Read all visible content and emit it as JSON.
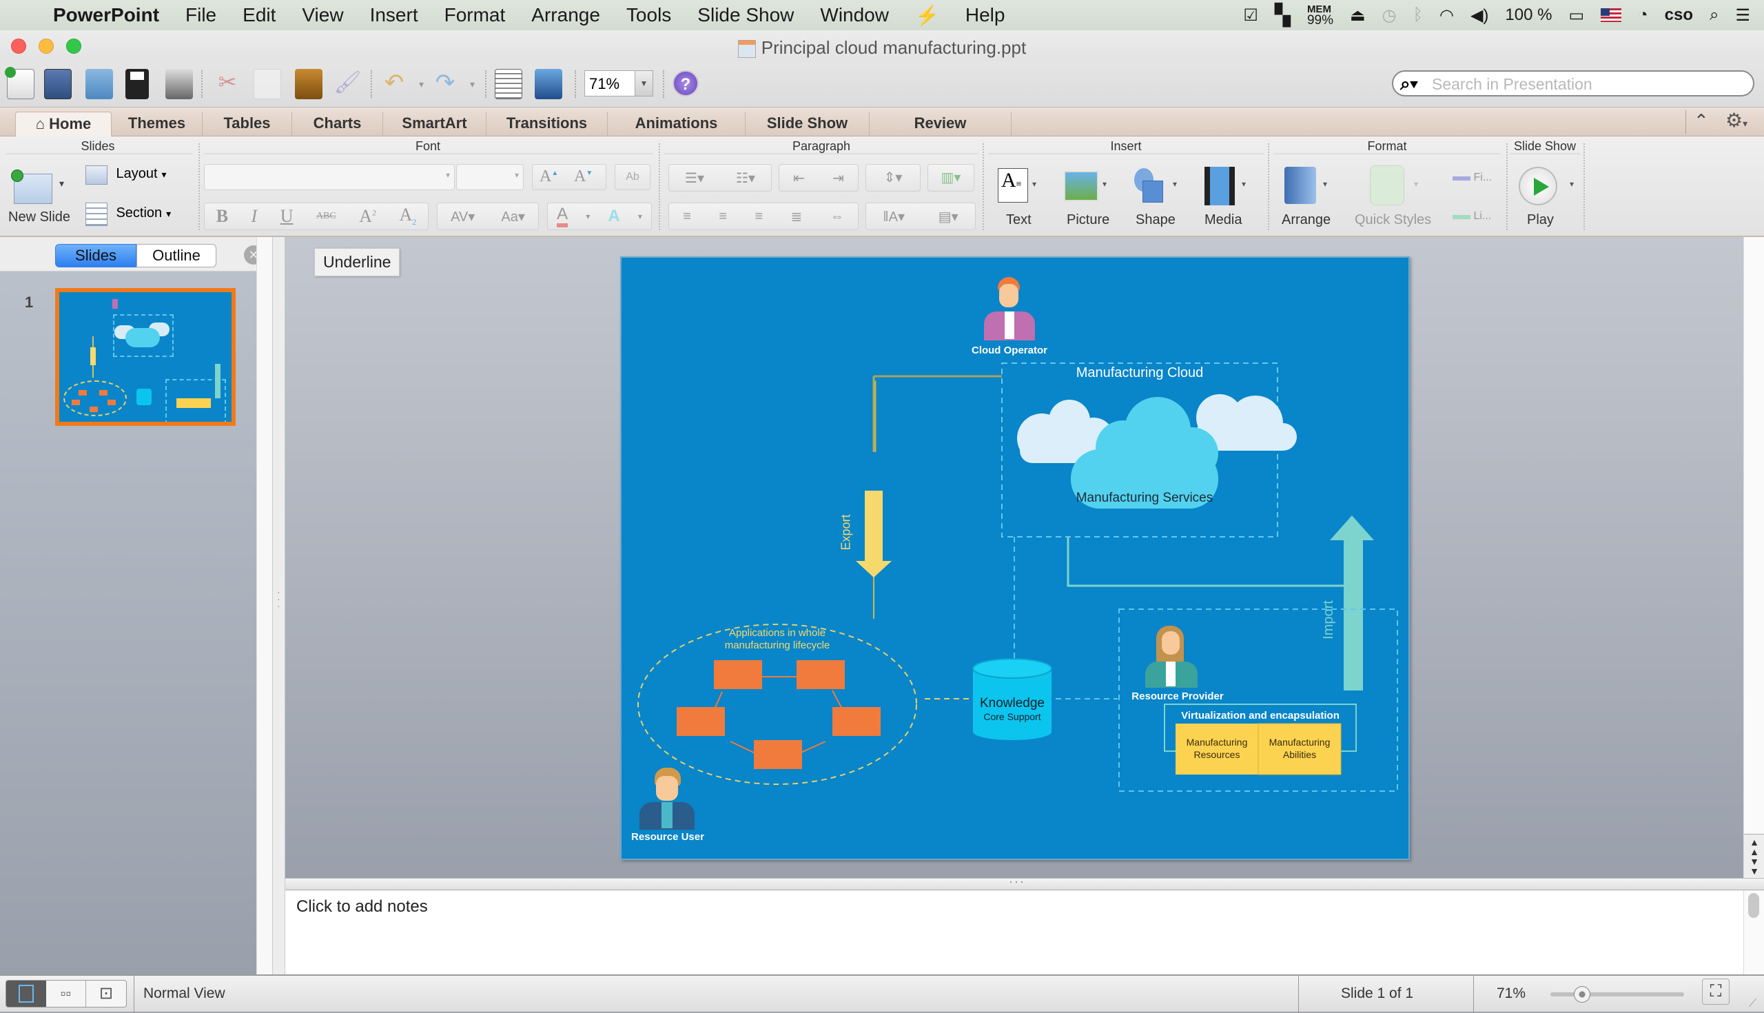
{
  "menubar": {
    "app_name": "PowerPoint",
    "items": [
      "File",
      "Edit",
      "View",
      "Insert",
      "Format",
      "Arrange",
      "Tools",
      "Slide Show",
      "Window",
      "Help"
    ],
    "status": {
      "mem_label": "MEM",
      "mem_value": "99%",
      "battery": "100 %",
      "user": "cso"
    }
  },
  "window": {
    "title": "Principal cloud manufacturing.ppt"
  },
  "toolbar": {
    "zoom_value": "71%",
    "search_placeholder": "Search in Presentation"
  },
  "ribbon": {
    "tabs": [
      "Home",
      "Themes",
      "Tables",
      "Charts",
      "SmartArt",
      "Transitions",
      "Animations",
      "Slide Show",
      "Review"
    ],
    "active_tab": "Home",
    "groups": {
      "slides": {
        "label": "Slides",
        "new_slide": "New Slide",
        "layout": "Layout",
        "section": "Section"
      },
      "font": {
        "label": "Font"
      },
      "paragraph": {
        "label": "Paragraph"
      },
      "insert": {
        "label": "Insert",
        "text": "Text",
        "picture": "Picture",
        "shape": "Shape",
        "media": "Media"
      },
      "format": {
        "label": "Format",
        "arrange": "Arrange",
        "quick_styles": "Quick Styles",
        "fill": "Fi...",
        "line": "Li..."
      },
      "slideshow": {
        "label": "Slide Show",
        "play": "Play"
      }
    }
  },
  "left_pane": {
    "tabs": [
      "Slides",
      "Outline"
    ],
    "active": "Slides",
    "slide_numbers": [
      "1"
    ]
  },
  "tooltip": "Underline",
  "slide": {
    "background": "#0985c9",
    "cloud_operator": "Cloud Operator",
    "manufacturing_cloud": "Manufacturing Cloud",
    "manufacturing_services": "Manufacturing Services",
    "export": "Export",
    "import": "Import",
    "applications": [
      "Applications in whole",
      "manufacturing lifecycle"
    ],
    "knowledge": "Knowledge",
    "core_support": "Core Support",
    "resource_provider": "Resource Provider",
    "virtualization": "Virtualization and encapsulation",
    "resources": [
      "Manufacturing",
      "Resources"
    ],
    "abilities": [
      "Manufacturing",
      "Abilities"
    ],
    "resource_user": "Resource User"
  },
  "notes": {
    "placeholder": "Click to add notes"
  },
  "status_bar": {
    "view_name": "Normal View",
    "slide_counter": "Slide 1 of 1",
    "zoom": "71%",
    "zoom_fraction": 0.2
  }
}
